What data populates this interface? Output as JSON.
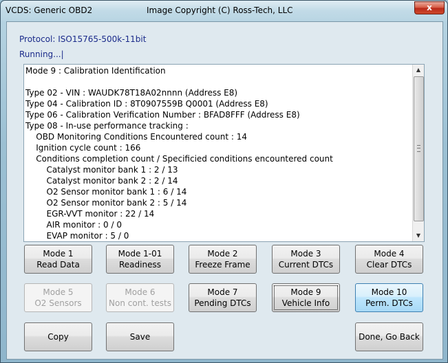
{
  "window": {
    "title": "VCDS:  Generic OBD2",
    "copyright": "Image Copyright (C) Ross-Tech, LLC",
    "close_glyph": "x"
  },
  "protocol": "Protocol:  ISO15765-500k-11bit",
  "status": "Running...|",
  "output_lines": [
    "Mode 9 : Calibration Identification",
    "",
    "Type 02 - VIN : WAUDK78T18A02nnnn (Address E8)",
    "Type 04 - Calibration ID : 8T0907559B Q0001 (Address E8)",
    "Type 06 - Calibration Verification Number : BFAD8FFF (Address E8)",
    "Type 08 - In-use performance tracking :",
    "    OBD Monitoring Conditions Encountered count : 14",
    "    Ignition cycle count : 166",
    "    Conditions completion count / Specificied conditions encountered count",
    "        Catalyst monitor bank 1 : 2 / 13",
    "        Catalyst monitor bank 2 : 2 / 14",
    "        O2 Sensor monitor bank 1 : 6 / 14",
    "        O2 Sensor monitor bank 2 : 5 / 14",
    "        EGR-VVT monitor : 22 / 14",
    "        AIR monitor : 0 / 0",
    "        EVAP monitor : 5 / 0"
  ],
  "scrollbar": {
    "up_glyph": "▲",
    "down_glyph": "▼"
  },
  "buttons": {
    "mode1": {
      "l1": "Mode 1",
      "l2": "Read Data"
    },
    "mode101": {
      "l1": "Mode 1-01",
      "l2": "Readiness"
    },
    "mode2": {
      "l1": "Mode 2",
      "l2": "Freeze Frame"
    },
    "mode3": {
      "l1": "Mode 3",
      "l2": "Current DTCs"
    },
    "mode4": {
      "l1": "Mode 4",
      "l2": "Clear DTCs"
    },
    "mode5": {
      "l1": "Mode 5",
      "l2": "O2 Sensors"
    },
    "mode6": {
      "l1": "Mode 6",
      "l2": "Non cont. tests"
    },
    "mode7": {
      "l1": "Mode 7",
      "l2": "Pending DTCs"
    },
    "mode9": {
      "l1": "Mode 9",
      "l2": "Vehicle Info"
    },
    "mode10": {
      "l1": "Mode 10",
      "l2": "Perm. DTCs"
    },
    "copy": "Copy",
    "save": "Save",
    "done": "Done, Go Back"
  }
}
